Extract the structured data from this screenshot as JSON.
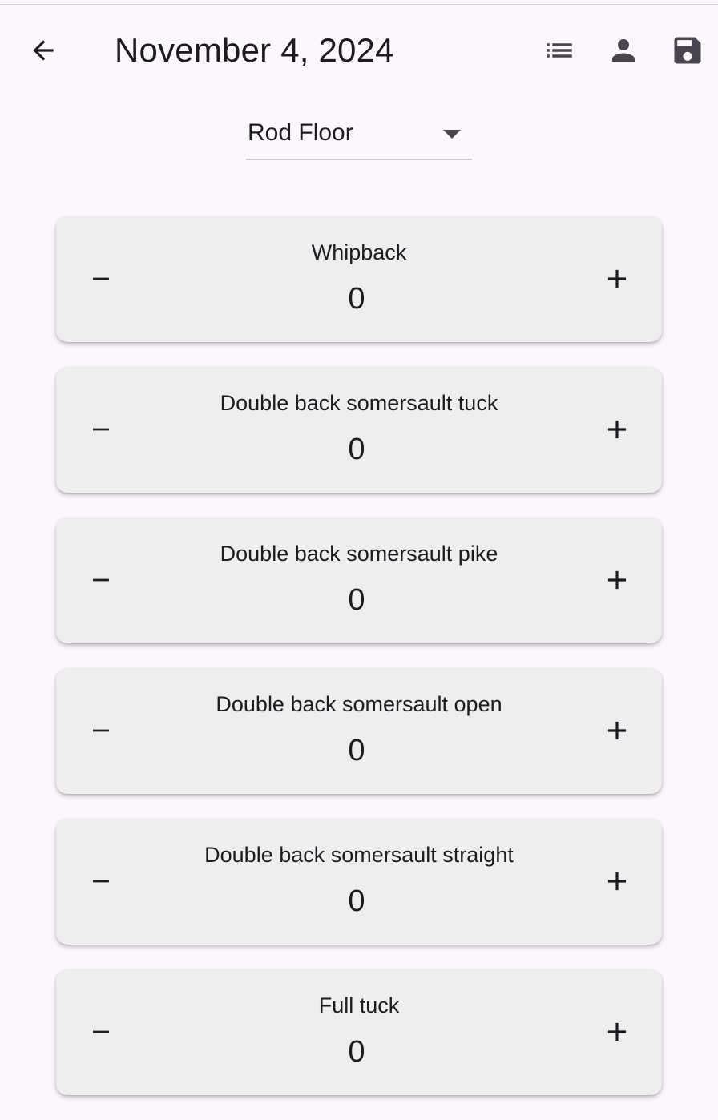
{
  "header": {
    "title": "November 4, 2024",
    "icons": {
      "back": "arrow-back-icon",
      "list": "list-icon",
      "person": "person-icon",
      "save": "save-icon"
    }
  },
  "selector": {
    "value": "Rod Floor",
    "icon": "dropdown-arrow-icon"
  },
  "skills": [
    {
      "name": "Whipback",
      "count": "0"
    },
    {
      "name": "Double back somersault tuck",
      "count": "0"
    },
    {
      "name": "Double back somersault pike",
      "count": "0"
    },
    {
      "name": "Double back somersault open",
      "count": "0"
    },
    {
      "name": "Double back somersault straight",
      "count": "0"
    },
    {
      "name": "Full tuck",
      "count": "0"
    }
  ],
  "colors": {
    "background": "#fdf7fd",
    "card": "#efeeef",
    "text": "#1d1b20",
    "icon": "#1d1b20"
  }
}
